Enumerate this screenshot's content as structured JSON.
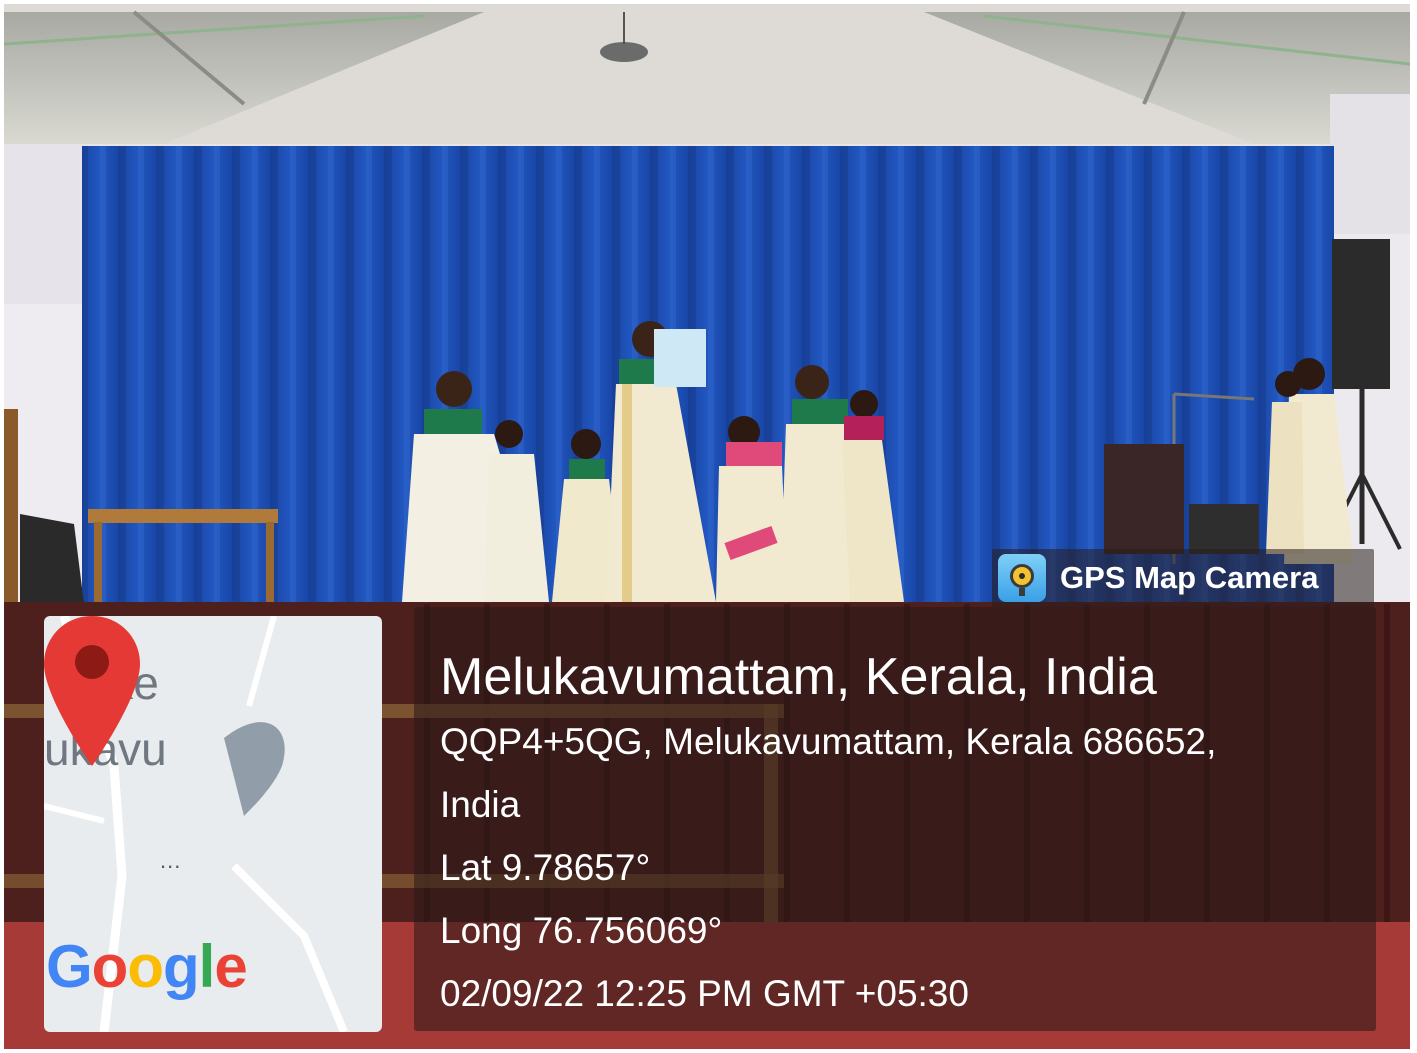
{
  "gps_badge": {
    "label": "GPS Map Camera",
    "icon": "gps-map-camera-app-icon"
  },
  "map": {
    "place_text_1": "Bake",
    "place_text_2": "ukavu",
    "ellipsis": "...",
    "provider_logo": "Google",
    "pin_icon": "location-pin-icon",
    "pin_color": "#e53935"
  },
  "location": {
    "title": "Melukavumattam, Kerala, India",
    "address_line_1": "QQP4+5QG, Melukavumattam, Kerala 686652,",
    "address_line_2": "India",
    "latitude": "Lat 9.78657°",
    "longitude": "Long 76.756069°",
    "timestamp": "02/09/22 12:25 PM GMT +05:30"
  },
  "colors": {
    "curtain": "#1f4fb0",
    "stage_floor": "#5a2420",
    "panel_overlay": "rgba(40, 24, 24, 0.55)",
    "text": "#ffffff"
  }
}
